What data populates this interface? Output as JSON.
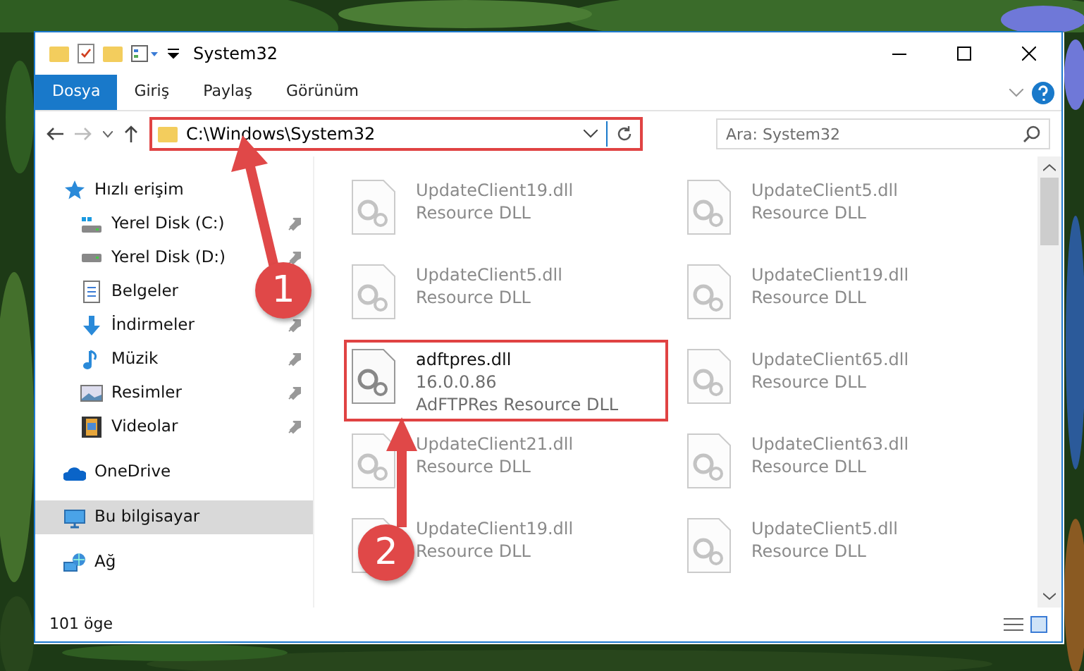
{
  "window": {
    "title": "System32"
  },
  "ribbon_tabs": [
    {
      "label": "Dosya",
      "selected": true
    },
    {
      "label": "Giriş",
      "selected": false
    },
    {
      "label": "Paylaş",
      "selected": false
    },
    {
      "label": "Görünüm",
      "selected": false
    }
  ],
  "address": {
    "path": "C:\\Windows\\System32"
  },
  "search": {
    "placeholder": "Ara: System32"
  },
  "sidebar": {
    "items": [
      {
        "label": "Hızlı erişim",
        "selected": false,
        "children": [
          {
            "label": "Yerel Disk (C:)",
            "pinned": true
          },
          {
            "label": "Yerel Disk (D:)",
            "pinned": true
          },
          {
            "label": "Belgeler",
            "pinned": false
          },
          {
            "label": "İndirmeler",
            "pinned": true
          },
          {
            "label": "Müzik",
            "pinned": true
          },
          {
            "label": "Resimler",
            "pinned": true
          },
          {
            "label": "Videolar",
            "pinned": true
          }
        ]
      },
      {
        "label": "OneDrive",
        "selected": false
      },
      {
        "label": "Bu bilgisayar",
        "selected": true
      },
      {
        "label": "Ağ",
        "selected": false
      }
    ]
  },
  "files": [
    {
      "name": "UpdateClient19.dll",
      "lines": [
        "Resource DLL"
      ],
      "faded": true
    },
    {
      "name": "UpdateClient5.dll",
      "lines": [
        "Resource DLL"
      ],
      "faded": true
    },
    {
      "name": "UpdateClient5.dll",
      "lines": [
        "Resource DLL"
      ],
      "faded": true
    },
    {
      "name": "UpdateClient19.dll",
      "lines": [
        "Resource DLL"
      ],
      "faded": true
    },
    {
      "name": "adftpres.dll",
      "lines": [
        "16.0.0.86",
        "AdFTPRes Resource DLL"
      ],
      "faded": false
    },
    {
      "name": "UpdateClient65.dll",
      "lines": [
        "Resource DLL"
      ],
      "faded": true
    },
    {
      "name": "UpdateClient21.dll",
      "lines": [
        "Resource DLL"
      ],
      "faded": true
    },
    {
      "name": "UpdateClient63.dll",
      "lines": [
        "Resource DLL"
      ],
      "faded": true
    },
    {
      "name": "UpdateClient19.dll",
      "lines": [
        "Resource DLL"
      ],
      "faded": true
    },
    {
      "name": "UpdateClient5.dll",
      "lines": [
        "Resource DLL"
      ],
      "faded": true
    }
  ],
  "status_bar": {
    "count": "101 öge"
  },
  "annotations": [
    {
      "label": "1"
    },
    {
      "label": "2"
    }
  ]
}
